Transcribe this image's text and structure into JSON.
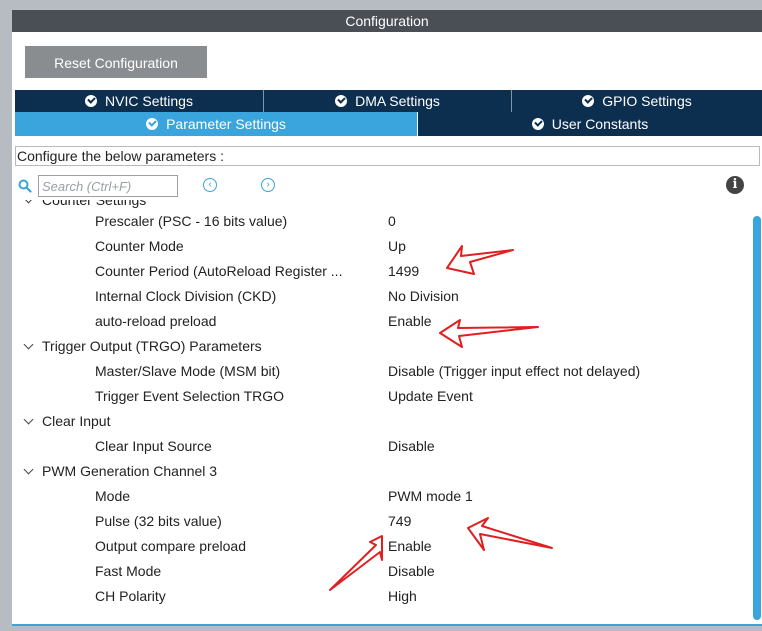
{
  "window": {
    "title": "Configuration"
  },
  "toolbar": {
    "reset_label": "Reset Configuration"
  },
  "tabs_row1": [
    {
      "label": "NVIC Settings"
    },
    {
      "label": "DMA Settings"
    },
    {
      "label": "GPIO Settings"
    }
  ],
  "tabs_row2": [
    {
      "label": "Parameter Settings",
      "active": true
    },
    {
      "label": "User Constants",
      "active": false
    }
  ],
  "description": "Configure the below parameters :",
  "search": {
    "placeholder": "Search (Ctrl+F)"
  },
  "params": {
    "counter_group": "Counter Settings",
    "prescaler": {
      "name": "Prescaler (PSC - 16 bits value)",
      "value": "0"
    },
    "counter_mode": {
      "name": "Counter Mode",
      "value": "Up"
    },
    "counter_period": {
      "name": "Counter Period (AutoReload Register ...",
      "value": "1499"
    },
    "clock_division": {
      "name": "Internal Clock Division (CKD)",
      "value": "No Division"
    },
    "autoreload": {
      "name": "auto-reload preload",
      "value": "Enable"
    },
    "trgo_group": "Trigger Output (TRGO) Parameters",
    "msm": {
      "name": "Master/Slave Mode (MSM bit)",
      "value": "Disable (Trigger input effect not delayed)"
    },
    "trgo_sel": {
      "name": "Trigger Event Selection TRGO",
      "value": "Update Event"
    },
    "clear_group": "Clear Input",
    "clear_src": {
      "name": "Clear Input Source",
      "value": "Disable"
    },
    "pwm_group": "PWM Generation Channel 3",
    "mode": {
      "name": "Mode",
      "value": "PWM mode 1"
    },
    "pulse": {
      "name": "Pulse (32 bits value)",
      "value": "749"
    },
    "oc_preload": {
      "name": "Output compare preload",
      "value": "Enable"
    },
    "fast_mode": {
      "name": "Fast Mode",
      "value": "Disable"
    },
    "polarity": {
      "name": "CH Polarity",
      "value": "High"
    }
  },
  "colors": {
    "tab_dark": "#0c2f4f",
    "tab_active": "#3aa4dc",
    "annotation": "#e02020"
  }
}
